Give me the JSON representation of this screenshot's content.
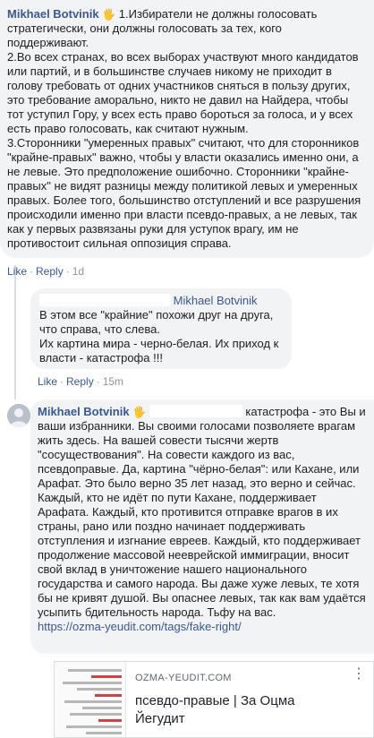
{
  "comment1": {
    "author": "Mikhael Botvinik",
    "hand": "🖐",
    "paragraphs": [
      "1.Избиратели не должны голосовать стратегически, они должны голосовать за тех, кого поддерживают.",
      "2.Во всех странах, во всех выборах участвуют много кандидатов или партий, и в большинстве случаев никому не приходит в голову требовать от одних участников сняться в пользу других, это требование аморально, никто не давил на Найдера, чтобы тот уступил Гору, у всех есть право бороться за голоса, и у всех есть право голосовать, как считают нужным.",
      "3.Сторонники \"умеренных правых\" считают, что для сторонников \"крайне-правых\" важно, чтобы у власти оказались именно они, а не левые. Это предположение ошибочно. Сторонники \"крайне-правых\" не видят разницы между политикой левых и умеренных правых. Более того, большинство отступлений и все разрушения происходили именно при власти псевдо-правых, а не левых, так как у первых развязаны руки для уступок врагу, им не противостоит сильная оппозиция справа."
    ],
    "like": "Like",
    "reply": "Reply",
    "time": "1d"
  },
  "reply1": {
    "mention": "Mikhael Botvinik",
    "lines": [
      "В этом все \"крайние\" похожи друг на друга, что справа, что слева.",
      "Их картина мира - черно-белая. Их приход к власти - катастрофа !!!"
    ],
    "like": "Like",
    "reply": "Reply",
    "time": "15m"
  },
  "reply2": {
    "author": "Mikhael Botvinik",
    "hand": "🖐",
    "quote": "катастрофа -",
    "body": "это Вы и ваши избранники. Вы своими голосами позволяете врагам жить здесь. На вашей совести тысячи жертв \"сосуществования\". На совести каждого из вас, псевдоправые. Да, картина \"чёрно-белая\": или Кахане, или Арафат. Это было верно 35 лет назад, это верно и сейчас. Каждый, кто не идёт по пути Кахане, поддерживает Арафата. Каждый, кто противится отправке врагов в их страны, рано или поздно начинает поддерживать отступления и изгнание евреев. Каждый, кто поддерживает продолжение массовой нееврейской иммиграции, вносит свой вклад в уничтожение нашего национального государства и самого народа. Вы даже хуже левых, те хотя бы не кривят душой. Вы опаснее левых, так как вам удаётся усыпить бдительность народа. Тьфу на вас.",
    "url": "https://ozma-yeudit.com/tags/fake-right/"
  },
  "link_preview": {
    "domain": "OZMA-YEUDIT.COM",
    "title": "псевдо-правые | За Оцма Йегудит",
    "more_icon": "⋮"
  }
}
